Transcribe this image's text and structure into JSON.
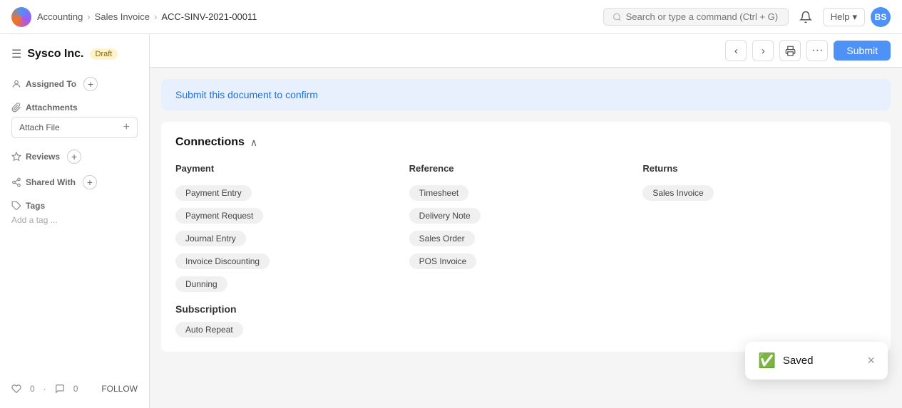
{
  "topnav": {
    "breadcrumb": [
      "Accounting",
      "Sales Invoice",
      "ACC-SINV-2021-00011"
    ],
    "search_placeholder": "Search or type a command (Ctrl + G)",
    "help_label": "Help",
    "avatar_initials": "BS"
  },
  "sidebar": {
    "title": "Sysco Inc.",
    "status": "Draft",
    "assigned_to_label": "Assigned To",
    "attachments_label": "Attachments",
    "attach_file_label": "Attach File",
    "reviews_label": "Reviews",
    "shared_with_label": "Shared With",
    "tags_label": "Tags",
    "add_tag_placeholder": "Add a tag ...",
    "likes_count": "0",
    "comments_count": "0",
    "follow_label": "FOLLOW"
  },
  "toolbar": {
    "submit_label": "Submit"
  },
  "notice": {
    "text": "Submit this document to confirm"
  },
  "connections": {
    "title": "Connections",
    "payment_title": "Payment",
    "payment_items": [
      "Payment Entry",
      "Payment Request",
      "Journal Entry",
      "Invoice Discounting",
      "Dunning"
    ],
    "reference_title": "Reference",
    "reference_items": [
      "Timesheet",
      "Delivery Note",
      "Sales Order",
      "POS Invoice"
    ],
    "returns_title": "Returns",
    "returns_items": [
      "Sales Invoice"
    ],
    "subscription_title": "Subscription",
    "subscription_items": [
      "Auto Repeat"
    ]
  },
  "toast": {
    "message": "Saved",
    "close_label": "×"
  }
}
